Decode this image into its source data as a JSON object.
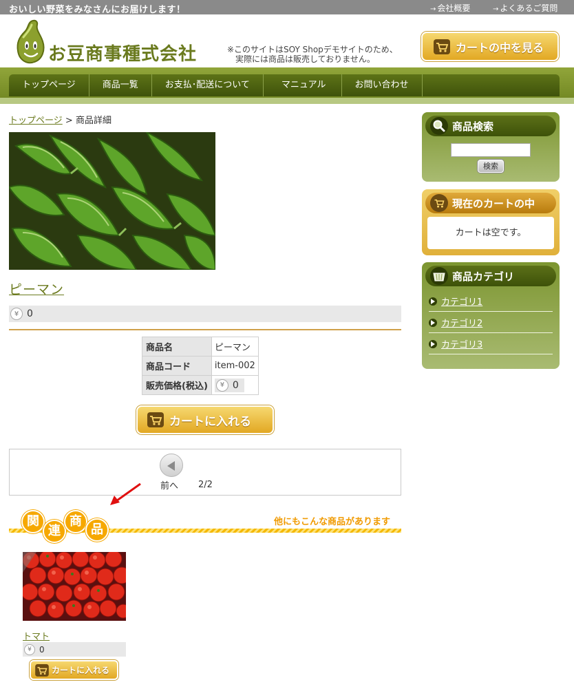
{
  "topbar": {
    "tagline": "おいしい野菜をみなさんにお届けします！",
    "links": [
      {
        "label": "会社概要"
      },
      {
        "label": "よくあるご質問"
      }
    ]
  },
  "header": {
    "company_name": "お豆商事種式会社",
    "demo_note_line1": "※このサイトはSOY Shopデモサイトのため、",
    "demo_note_line2": "実際には商品は販売しておりません。",
    "cart_view_label": "カートの中を見る"
  },
  "nav": {
    "items": [
      {
        "label": "トップページ"
      },
      {
        "label": "商品一覧"
      },
      {
        "label": "お支払･配送について"
      },
      {
        "label": "マニュアル"
      },
      {
        "label": "お問い合わせ"
      }
    ]
  },
  "breadcrumb": {
    "home": "トップページ",
    "separator": ">",
    "current": "商品詳細"
  },
  "product": {
    "name": "ピーマン",
    "price": "0",
    "yen_symbol": "¥",
    "spec": [
      {
        "label": "商品名",
        "value": "ピーマン"
      },
      {
        "label": "商品コード",
        "value": "item-002"
      },
      {
        "label": "販売価格(税込)",
        "value": "0"
      }
    ],
    "add_to_cart_label": "カートに入れる"
  },
  "pager": {
    "prev_label": "前へ",
    "page_info": "2/2"
  },
  "related": {
    "chars": [
      "関",
      "連",
      "商",
      "品"
    ],
    "tagline": "他にもこんな商品があります",
    "items": [
      {
        "name": "トマト",
        "price": "0",
        "add_to_cart_label": "カートに入れる"
      }
    ]
  },
  "sidebar": {
    "search": {
      "title": "商品検索",
      "button": "検索"
    },
    "cart": {
      "title": "現在のカートの中",
      "empty_text": "カートは空です。"
    },
    "categories": {
      "title": "商品カテゴリ",
      "items": [
        {
          "label": "カテゴリ1"
        },
        {
          "label": "カテゴリ2"
        },
        {
          "label": "カテゴリ3"
        }
      ]
    }
  },
  "colors": {
    "brand_green": "#6b7a1e",
    "nav_dark": "#3f530b",
    "gold": "#e2a823",
    "related_orange": "#f6a800"
  },
  "icons": [
    "cart-icon",
    "search-icon",
    "basket-icon",
    "yen-icon",
    "prev-arrow-icon",
    "bean-logo-icon"
  ]
}
